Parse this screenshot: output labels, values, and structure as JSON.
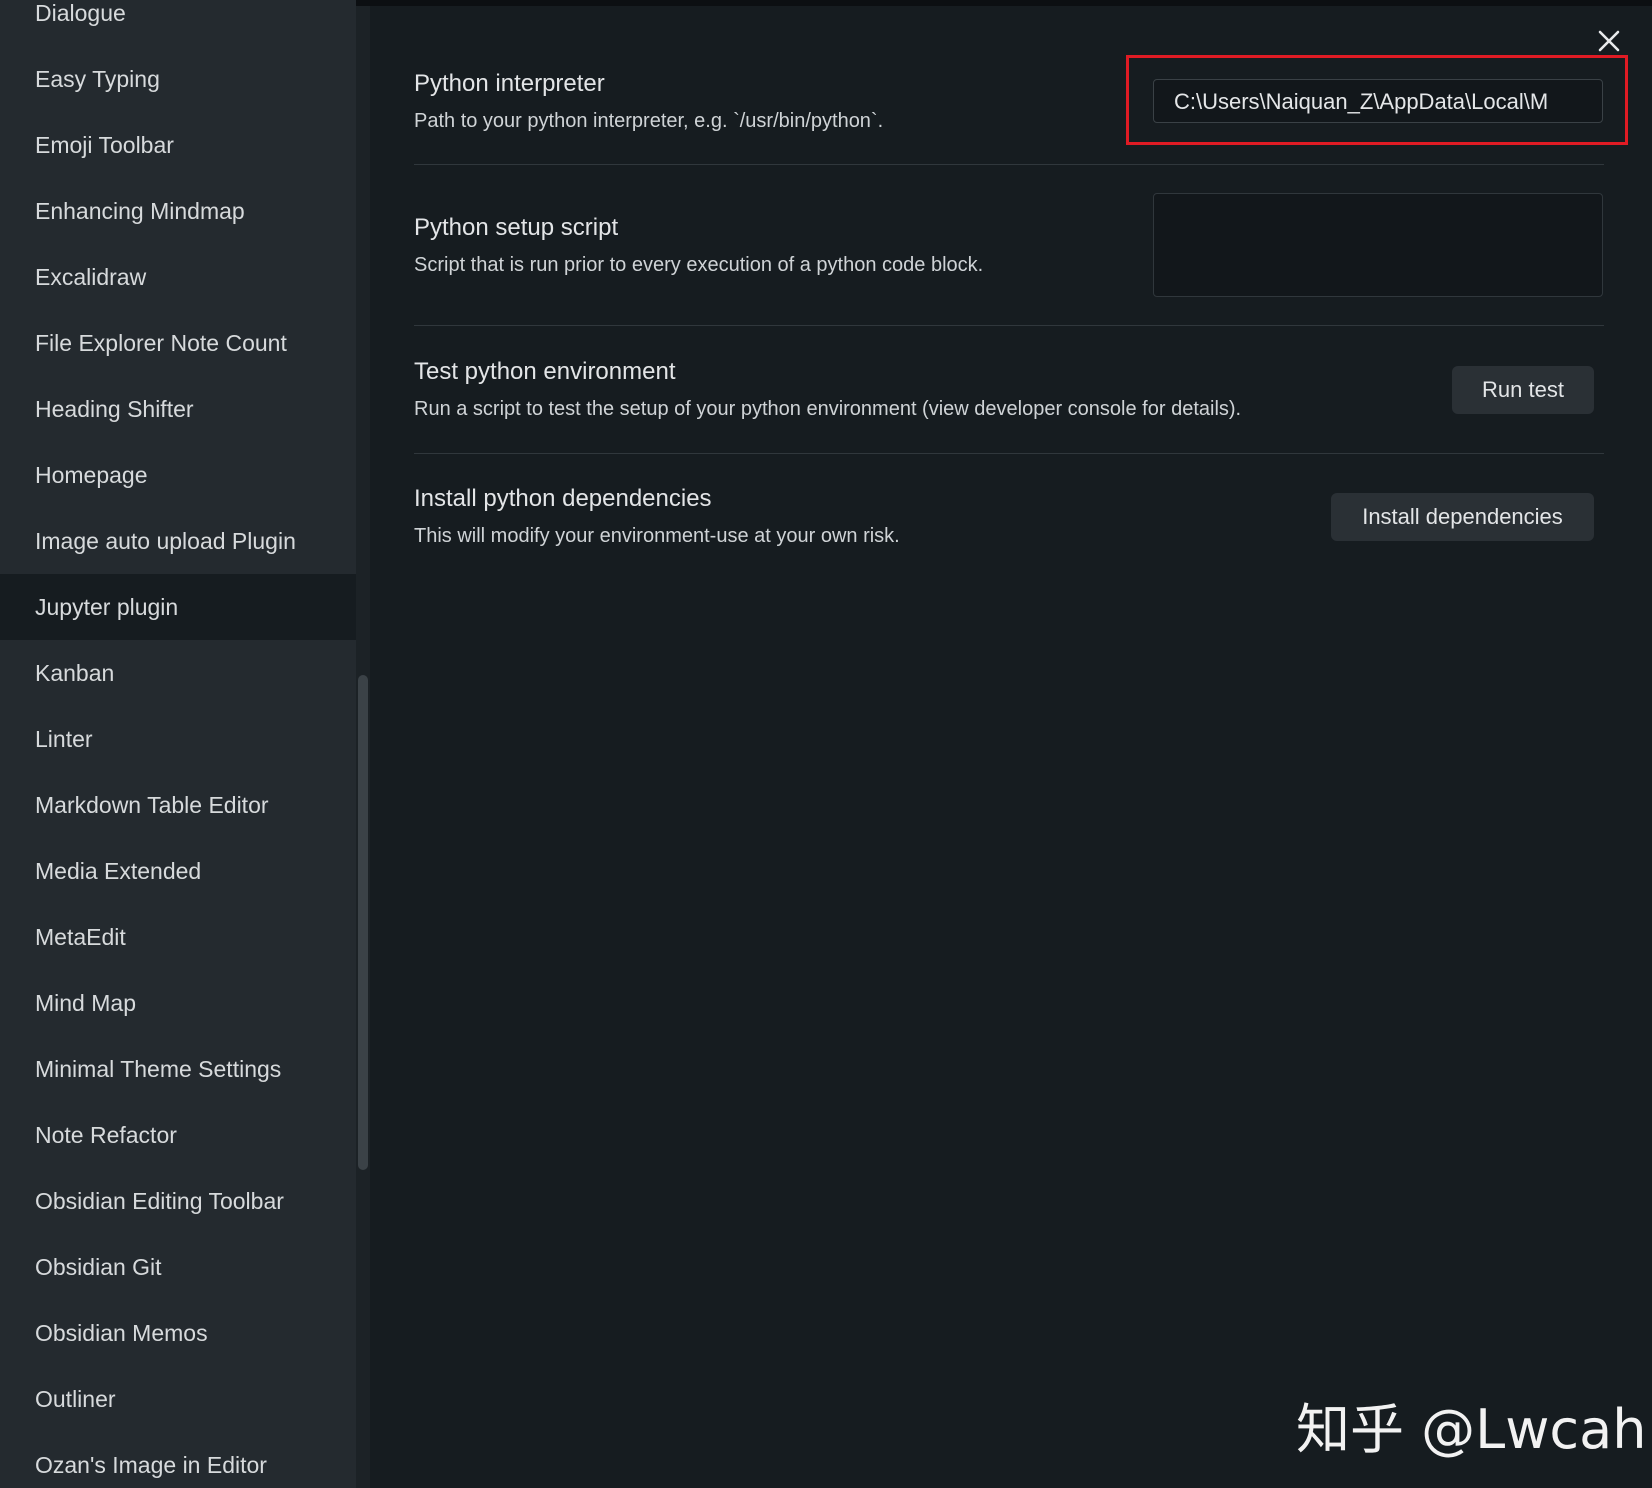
{
  "sidebar": {
    "items": [
      {
        "label": "Dialogue"
      },
      {
        "label": "Easy Typing"
      },
      {
        "label": "Emoji Toolbar"
      },
      {
        "label": "Enhancing Mindmap"
      },
      {
        "label": "Excalidraw"
      },
      {
        "label": "File Explorer Note Count"
      },
      {
        "label": "Heading Shifter"
      },
      {
        "label": "Homepage"
      },
      {
        "label": "Image auto upload Plugin"
      },
      {
        "label": "Jupyter plugin",
        "active": true
      },
      {
        "label": "Kanban"
      },
      {
        "label": "Linter"
      },
      {
        "label": "Markdown Table Editor"
      },
      {
        "label": "Media Extended"
      },
      {
        "label": "MetaEdit"
      },
      {
        "label": "Mind Map"
      },
      {
        "label": "Minimal Theme Settings"
      },
      {
        "label": "Note Refactor"
      },
      {
        "label": "Obsidian Editing Toolbar"
      },
      {
        "label": "Obsidian Git"
      },
      {
        "label": "Obsidian Memos"
      },
      {
        "label": "Outliner"
      },
      {
        "label": "Ozan's Image in Editor"
      }
    ]
  },
  "settings": {
    "interpreter": {
      "name": "Python interpreter",
      "desc": "Path to your python interpreter, e.g. `/usr/bin/python`.",
      "value": "C:\\Users\\Naiquan_Z\\AppData\\Local\\M"
    },
    "setup_script": {
      "name": "Python setup script",
      "desc": "Script that is run prior to every execution of a python code block.",
      "value": ""
    },
    "test_env": {
      "name": "Test python environment",
      "desc": "Run a script to test the setup of your python environment (view developer console for details).",
      "button": "Run test"
    },
    "install_deps": {
      "name": "Install python dependencies",
      "desc": "This will modify your environment-use at your own risk.",
      "button": "Install dependencies"
    }
  },
  "watermark": "知乎 @Lwcah",
  "colors": {
    "highlight": "#e01b24",
    "sidebar_bg": "#242a2f",
    "content_bg": "#161c20"
  }
}
